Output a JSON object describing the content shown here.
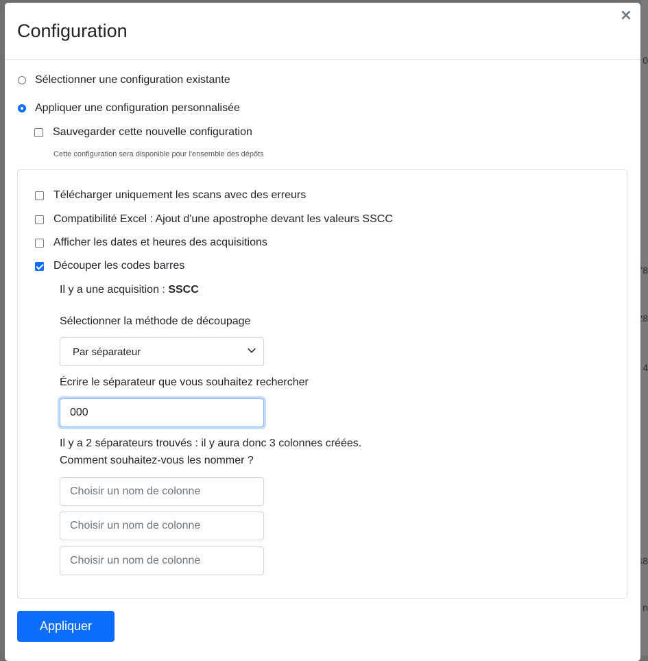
{
  "backdrop": {
    "fragments": [
      "0",
      "78",
      "28",
      "4",
      "48",
      "n"
    ]
  },
  "modal": {
    "title": "Configuration",
    "close_label": "×",
    "options": {
      "existing": "Sélectionner une configuration existante",
      "custom": "Appliquer une configuration personnalisée",
      "save_new": "Sauvegarder cette nouvelle configuration",
      "save_hint": "Cette configuration sera disponible pour l'ensemble des dépôts"
    },
    "settings": {
      "errors_only": "Télécharger uniquement les scans avec des erreurs",
      "excel_compat": "Compatibilité Excel : Ajout d'une apostrophe devant les valeurs SSCC",
      "show_dates": "Afficher les dates et heures des acquisitions",
      "split_barcodes": "Découper les codes barres"
    },
    "split": {
      "acquisition_prefix": "Il y a une acquisition : ",
      "acquisition_name": "SSCC",
      "method_label": "Sélectionner la méthode de découpage",
      "method_value": "Par séparateur",
      "separator_label": "Écrire le séparateur que vous souhaitez rechercher",
      "separator_value": "000",
      "found_text": "Il y a 2 séparateurs trouvés : il y aura donc 3 colonnes créées.",
      "question": "Comment souhaitez-vous les nommer ?",
      "column_placeholder": "Choisir un nom de colonne"
    },
    "apply_label": "Appliquer"
  }
}
